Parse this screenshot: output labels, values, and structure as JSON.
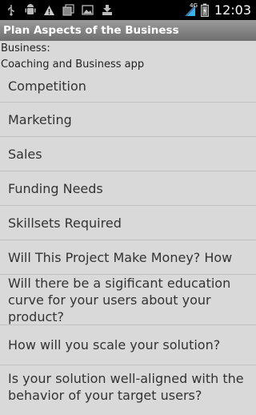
{
  "status_bar": {
    "time": "12:03",
    "network_type": "4G",
    "icons": [
      "usb-icon",
      "android-debug-icon",
      "warning-icon",
      "gallery-icon",
      "image-icon",
      "download-icon",
      "signal-icon",
      "battery-icon"
    ]
  },
  "title_bar": {
    "title": "Plan Aspects of the Business"
  },
  "business": {
    "label": "Business:",
    "name": "Coaching and Business app"
  },
  "items": [
    {
      "label": "Competition"
    },
    {
      "label": "Marketing"
    },
    {
      "label": "Sales"
    },
    {
      "label": "Funding Needs"
    },
    {
      "label": "Skillsets Required"
    },
    {
      "label": "Will This Project Make Money? How"
    },
    {
      "label": "Will there be a sigificant education curve for your users about your product?"
    },
    {
      "label": "How will you scale your solution?"
    },
    {
      "label": "Is your solution well-aligned with the behavior of your target users?"
    }
  ]
}
